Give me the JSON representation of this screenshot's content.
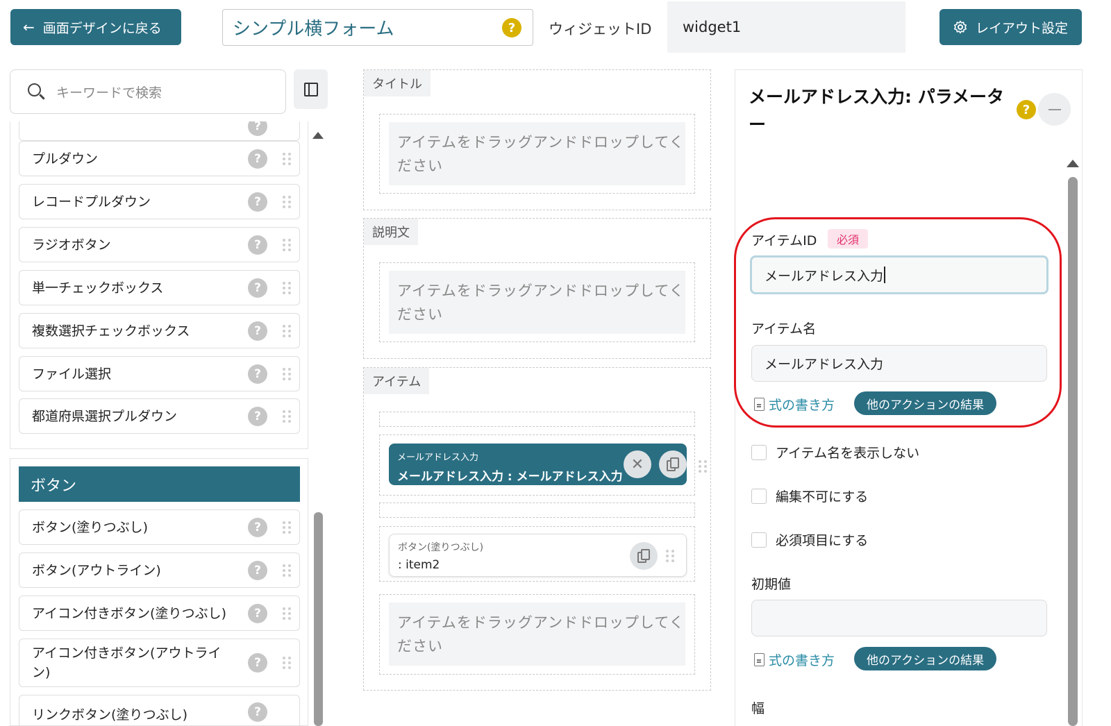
{
  "header": {
    "back_label": "画面デザインに戻る",
    "form_title": "シンプル横フォーム",
    "help_glyph": "?",
    "widget_id_label": "ウィジェットID",
    "widget_id_value": "widget1",
    "layout_label": "レイアウト設定"
  },
  "left": {
    "search_placeholder": "キーワードで検索",
    "items": [
      {
        "label": "プルダウン"
      },
      {
        "label": "レコードプルダウン"
      },
      {
        "label": "ラジオボタン"
      },
      {
        "label": "単一チェックボックス"
      },
      {
        "label": "複数選択チェックボックス"
      },
      {
        "label": "ファイル選択"
      },
      {
        "label": "都道府県選択プルダウン"
      }
    ],
    "button_group": {
      "title": "ボタン",
      "items": [
        {
          "label": "ボタン(塗りつぶし)"
        },
        {
          "label": "ボタン(アウトライン)"
        },
        {
          "label": "アイコン付きボタン(塗りつぶし)"
        },
        {
          "label": "アイコン付きボタン(アウトライン)"
        },
        {
          "label": "リンクボタン(塗りつぶし)"
        }
      ]
    }
  },
  "middle": {
    "sections": {
      "title": {
        "tag": "タイトル",
        "drop_text": "アイテムをドラッグアンドドロップしてください"
      },
      "description": {
        "tag": "説明文",
        "drop_text": "アイテムをドラッグアンドドロップしてください"
      },
      "items": {
        "tag": "アイテム",
        "drop_text": "アイテムをドラッグアンドドロップしてください"
      }
    },
    "selected_item": {
      "type": "メールアドレス入力",
      "name": "メールアドレス入力 : メールアドレス入力"
    },
    "button_item": {
      "type": "ボタン(塗りつぶし)",
      "name": ": item2"
    }
  },
  "params": {
    "title": "メールアドレス入力: パラメーター",
    "item_id_label": "アイテムID",
    "required_badge": "必須",
    "item_id_value": "メールアドレス入力",
    "item_name_label": "アイテム名",
    "item_name_value": "メールアドレス入力",
    "formula_link": "式の書き方",
    "action_result": "他のアクションの結果",
    "checks": [
      {
        "label": "アイテム名を表示しない",
        "checked": false
      },
      {
        "label": "編集不可にする",
        "checked": false
      },
      {
        "label": "必須項目にする",
        "checked": false
      }
    ],
    "initial_value_label": "初期値",
    "initial_value": "",
    "width_label": "幅"
  },
  "colors": {
    "primary": "#2a6e82",
    "help_yellow": "#d9b200",
    "highlight_red": "#e3141d",
    "link": "#2a8ca6",
    "required_pink": "#e0306a"
  }
}
